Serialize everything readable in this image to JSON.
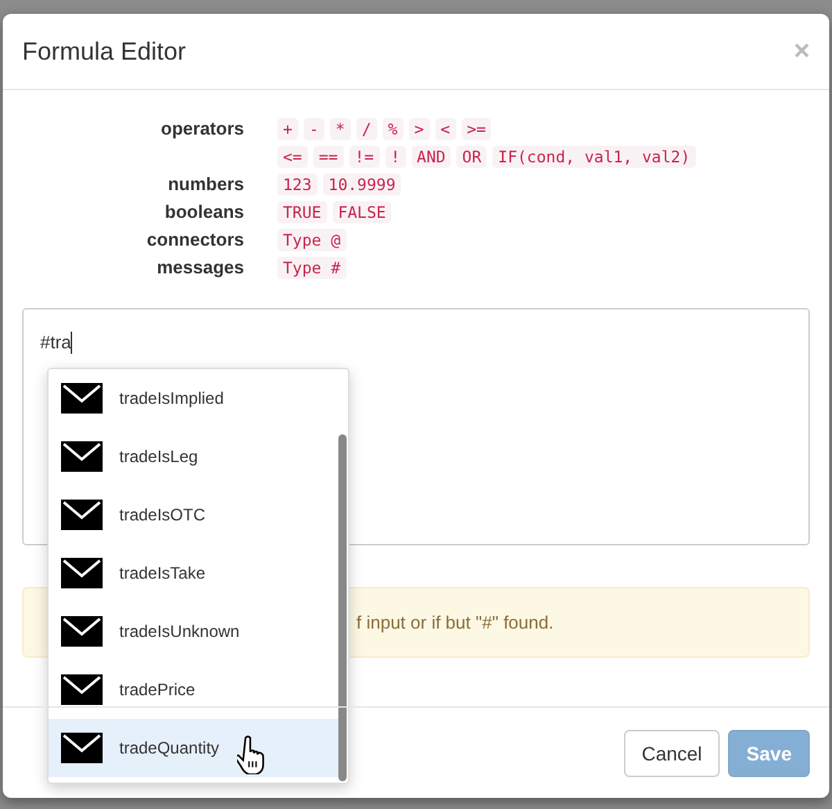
{
  "dialog": {
    "title": "Formula Editor",
    "close": "×"
  },
  "syntax": [
    {
      "label": "operators",
      "lines": [
        [
          "+",
          "-",
          "*",
          "/",
          "%",
          ">",
          "<",
          ">="
        ],
        [
          "<=",
          "==",
          "!=",
          "!",
          "AND",
          "OR",
          "IF(cond, val1, val2)"
        ]
      ]
    },
    {
      "label": "numbers",
      "lines": [
        [
          "123",
          "10.9999"
        ]
      ]
    },
    {
      "label": "booleans",
      "lines": [
        [
          "TRUE",
          "FALSE"
        ]
      ]
    },
    {
      "label": "connectors",
      "lines": [
        [
          "Type @"
        ]
      ]
    },
    {
      "label": "messages",
      "lines": [
        [
          "Type #"
        ]
      ]
    }
  ],
  "editor": {
    "value": "#tra"
  },
  "suggestions": [
    {
      "label": "tradeIsImplied",
      "selected": false
    },
    {
      "label": "tradeIsLeg",
      "selected": false
    },
    {
      "label": "tradeIsOTC",
      "selected": false
    },
    {
      "label": "tradeIsTake",
      "selected": false
    },
    {
      "label": "tradeIsUnknown",
      "selected": false
    },
    {
      "label": "tradePrice",
      "selected": false
    },
    {
      "label": "tradeQuantity",
      "selected": true
    }
  ],
  "warning": "f input or if but \"#\" found.",
  "buttons": [
    {
      "label": "Cancel",
      "kind": "default",
      "disabled": false
    },
    {
      "label": "Save",
      "kind": "primary",
      "disabled": true
    }
  ]
}
